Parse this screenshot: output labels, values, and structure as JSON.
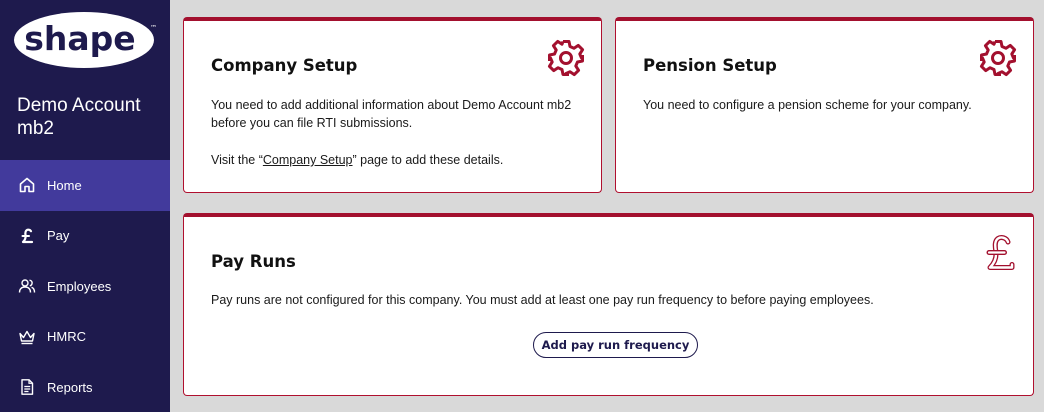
{
  "sidebar": {
    "logo_text": "shape",
    "logo_tm": "™",
    "account_name": "Demo Account mb2",
    "items": [
      {
        "label": "Home",
        "icon": "home-icon",
        "active": true
      },
      {
        "label": "Pay",
        "icon": "pound-icon",
        "active": false
      },
      {
        "label": "Employees",
        "icon": "users-icon",
        "active": false
      },
      {
        "label": "HMRC",
        "icon": "crown-icon",
        "active": false
      },
      {
        "label": "Reports",
        "icon": "report-icon",
        "active": false
      }
    ]
  },
  "cards": {
    "company": {
      "title": "Company Setup",
      "text1": "You need to add additional information about Demo Account mb2 before you can file RTI submissions.",
      "text2_prefix": "Visit the “",
      "text2_link": "Company Setup",
      "text2_suffix": "” page to add these details.",
      "icon": "gear-icon"
    },
    "pension": {
      "title": "Pension Setup",
      "text": "You need to configure a pension scheme for your company.",
      "icon": "gear-icon"
    },
    "payruns": {
      "title": "Pay Runs",
      "text": "Pay runs are not configured for this company. You must add at least one pay run frequency to before paying employees.",
      "button": "Add pay run frequency",
      "icon": "pound-icon"
    }
  },
  "colors": {
    "sidebar_bg": "#1e1a4d",
    "active_bg": "#423a9c",
    "accent": "#a3102e"
  }
}
